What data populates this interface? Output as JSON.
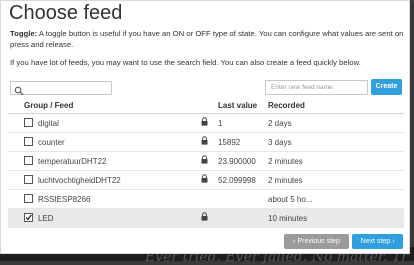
{
  "dialog": {
    "title": "Choose feed",
    "help_bold": "Toggle:",
    "help_text": "A toggle button is useful if you have an ON or OFF type of state. You can configure what values are sent on press and release.",
    "help_search": "If you have lot of feeds, you may want to use the search field. You can also create a feed quickly below."
  },
  "search": {
    "icon": "search-icon"
  },
  "new_feed": {
    "placeholder": "Enter new feed name",
    "button": "Create"
  },
  "table": {
    "headers": {
      "group": "Group / Feed",
      "last_value": "Last value",
      "recorded": "Recorded"
    },
    "rows": [
      {
        "name": "digital",
        "last_value": "1",
        "recorded": "2 days",
        "checked": false,
        "locked": true
      },
      {
        "name": "counter",
        "last_value": "15892",
        "recorded": "3 days",
        "checked": false,
        "locked": true
      },
      {
        "name": "temperatuurDHT22",
        "last_value": "23.900000",
        "recorded": "2 minutes",
        "checked": false,
        "locked": true
      },
      {
        "name": "luchtvochtigheidDHT22",
        "last_value": "52.099998",
        "recorded": "2 minutes",
        "checked": false,
        "locked": true
      },
      {
        "name": "RSSIESP8266",
        "last_value": "",
        "recorded": "about 5 ho...",
        "checked": false,
        "locked": false
      },
      {
        "name": "LED",
        "last_value": "",
        "recorded": "10 minutes",
        "checked": true,
        "locked": true
      }
    ]
  },
  "footer": {
    "previous": "Previous step",
    "next": "Next step"
  },
  "background": {
    "text": "Ever tried. Ever failed. No matter. Tr"
  },
  "colors": {
    "accent": "#2f9fe0",
    "secondary_button": "#9b9b9b",
    "selected_row": "#e9e9e9"
  }
}
